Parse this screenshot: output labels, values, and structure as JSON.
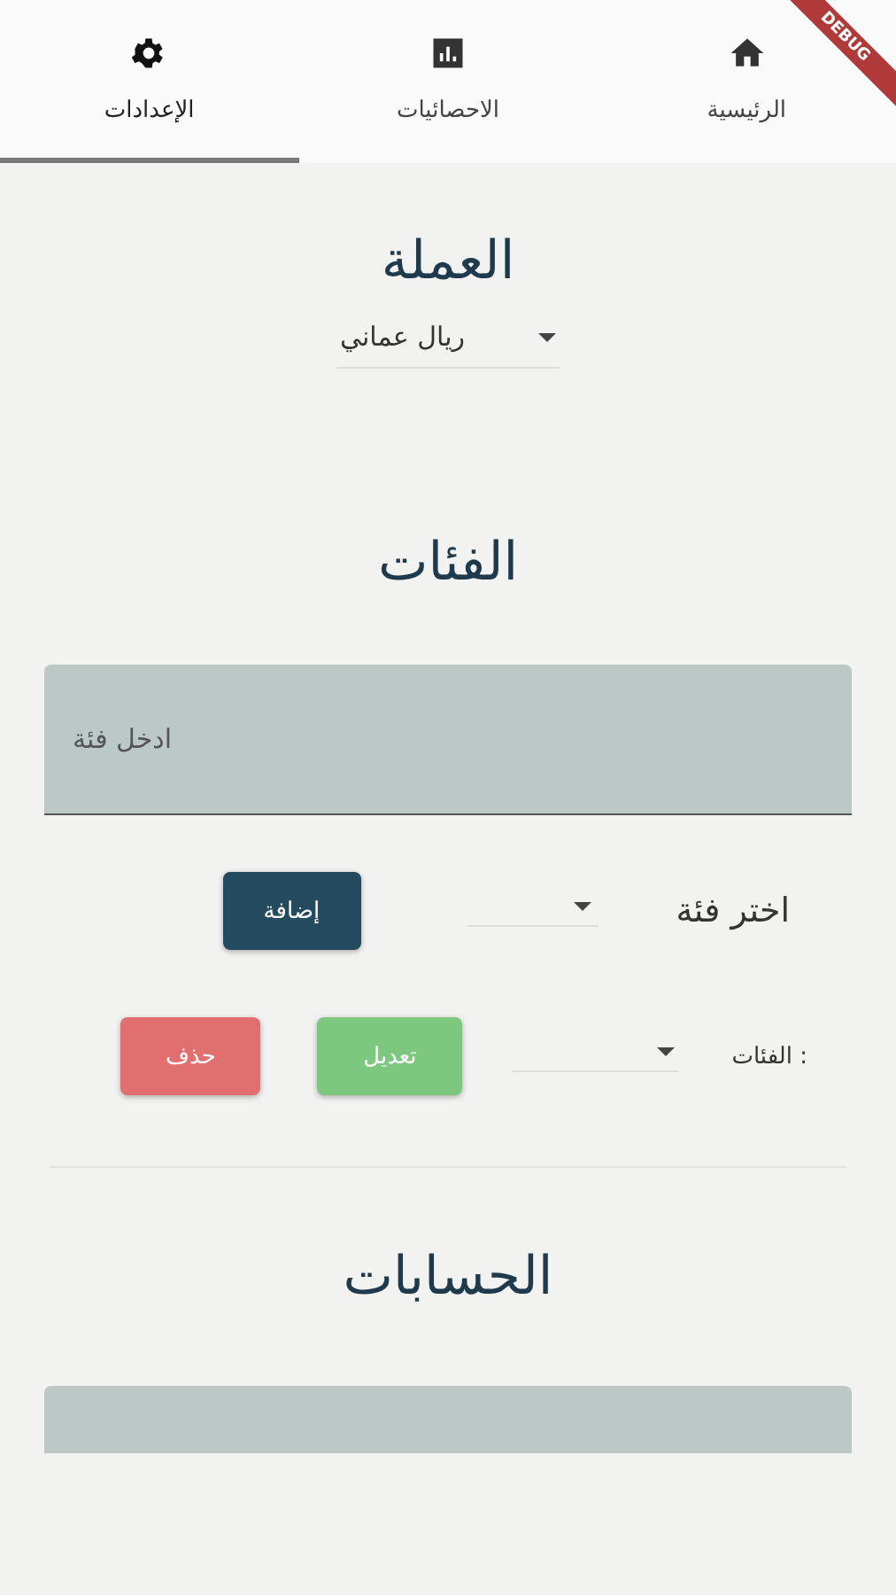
{
  "tabs": [
    {
      "label": "الرئيسية",
      "kind": "home",
      "selected": false
    },
    {
      "label": "الاحصائيات",
      "kind": "chart",
      "selected": false
    },
    {
      "label": "الإعدادات",
      "kind": "gear",
      "selected": true
    }
  ],
  "debug_banner": "DEBUG",
  "currency": {
    "title": "العملة",
    "dropdown": {
      "value": "ريال عماني"
    }
  },
  "categories": {
    "title": "الفئات",
    "input": {
      "placeholder": "ادخل فئة"
    },
    "add_row": {
      "label": "اختر فئة",
      "button": "إضافة"
    },
    "edit_row": {
      "label": "الفئات :",
      "edit_button": "تعديل",
      "delete_button": "حذف"
    }
  },
  "accounts": {
    "title": "الحسابات"
  }
}
